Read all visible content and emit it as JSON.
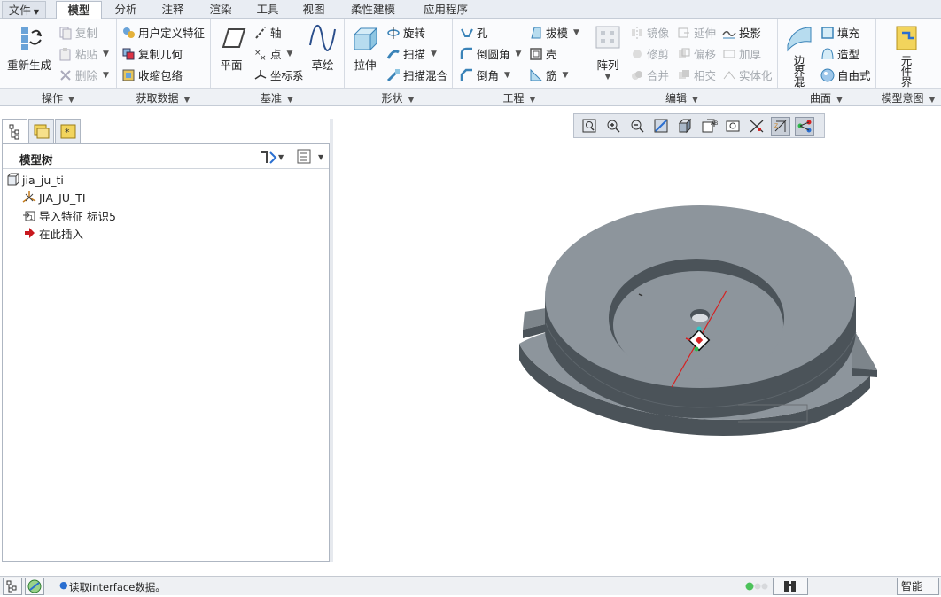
{
  "menu": {
    "file": "文件",
    "tabs": [
      "模型",
      "分析",
      "注释",
      "渲染",
      "工具",
      "视图",
      "柔性建模",
      "应用程序"
    ]
  },
  "ribbon": {
    "ops": {
      "regen": "重新生成",
      "copy": "复制",
      "paste": "粘贴",
      "delete": "删除",
      "group": "操作"
    },
    "getdata": {
      "udf": "用户定义特征",
      "copygeom": "复制几何",
      "shrinkwrap": "收缩包络",
      "group": "获取数据"
    },
    "datum": {
      "plane": "平面",
      "axis": "轴",
      "point": "点",
      "csys": "坐标系",
      "sketch": "草绘",
      "group": "基准"
    },
    "shapes": {
      "extrude": "拉伸",
      "revolve": "旋转",
      "sweep": "扫描",
      "sweptblend": "扫描混合",
      "group": "形状"
    },
    "engineering": {
      "hole": "孔",
      "round": "倒圆角",
      "chamfer": "倒角",
      "draft": "拔模",
      "shell": "壳",
      "rib": "筋",
      "group": "工程"
    },
    "editing": {
      "pattern": "阵列",
      "mirror": "镜像",
      "trim": "修剪",
      "merge": "合并",
      "extend": "延伸",
      "offset": "偏移",
      "intersect": "相交",
      "project": "投影",
      "thicken": "加厚",
      "solidify": "实体化",
      "group": "编辑"
    },
    "surfaces": {
      "boundary": "边界混合",
      "fill": "填充",
      "style": "造型",
      "freestyle": "自由式",
      "group": "曲面"
    },
    "intent": {
      "component": "元件界面",
      "group": "模型意图"
    }
  },
  "tree": {
    "title": "模型树",
    "items": [
      {
        "label": "jia_ju_ti",
        "icon": "part-icon"
      },
      {
        "label": "JIA_JU_TI",
        "icon": "csys-icon"
      },
      {
        "label": "导入特征 标识5",
        "icon": "import-feature-icon"
      },
      {
        "label": "在此插入",
        "icon": "insert-arrow-icon"
      }
    ]
  },
  "status": {
    "message": "读取interface数据。",
    "filter": "智能"
  },
  "colors": {
    "model_top": "#8d959c",
    "model_side": "#4b5359",
    "axis_line": "#d62020",
    "accent": "#2a6fd1"
  }
}
